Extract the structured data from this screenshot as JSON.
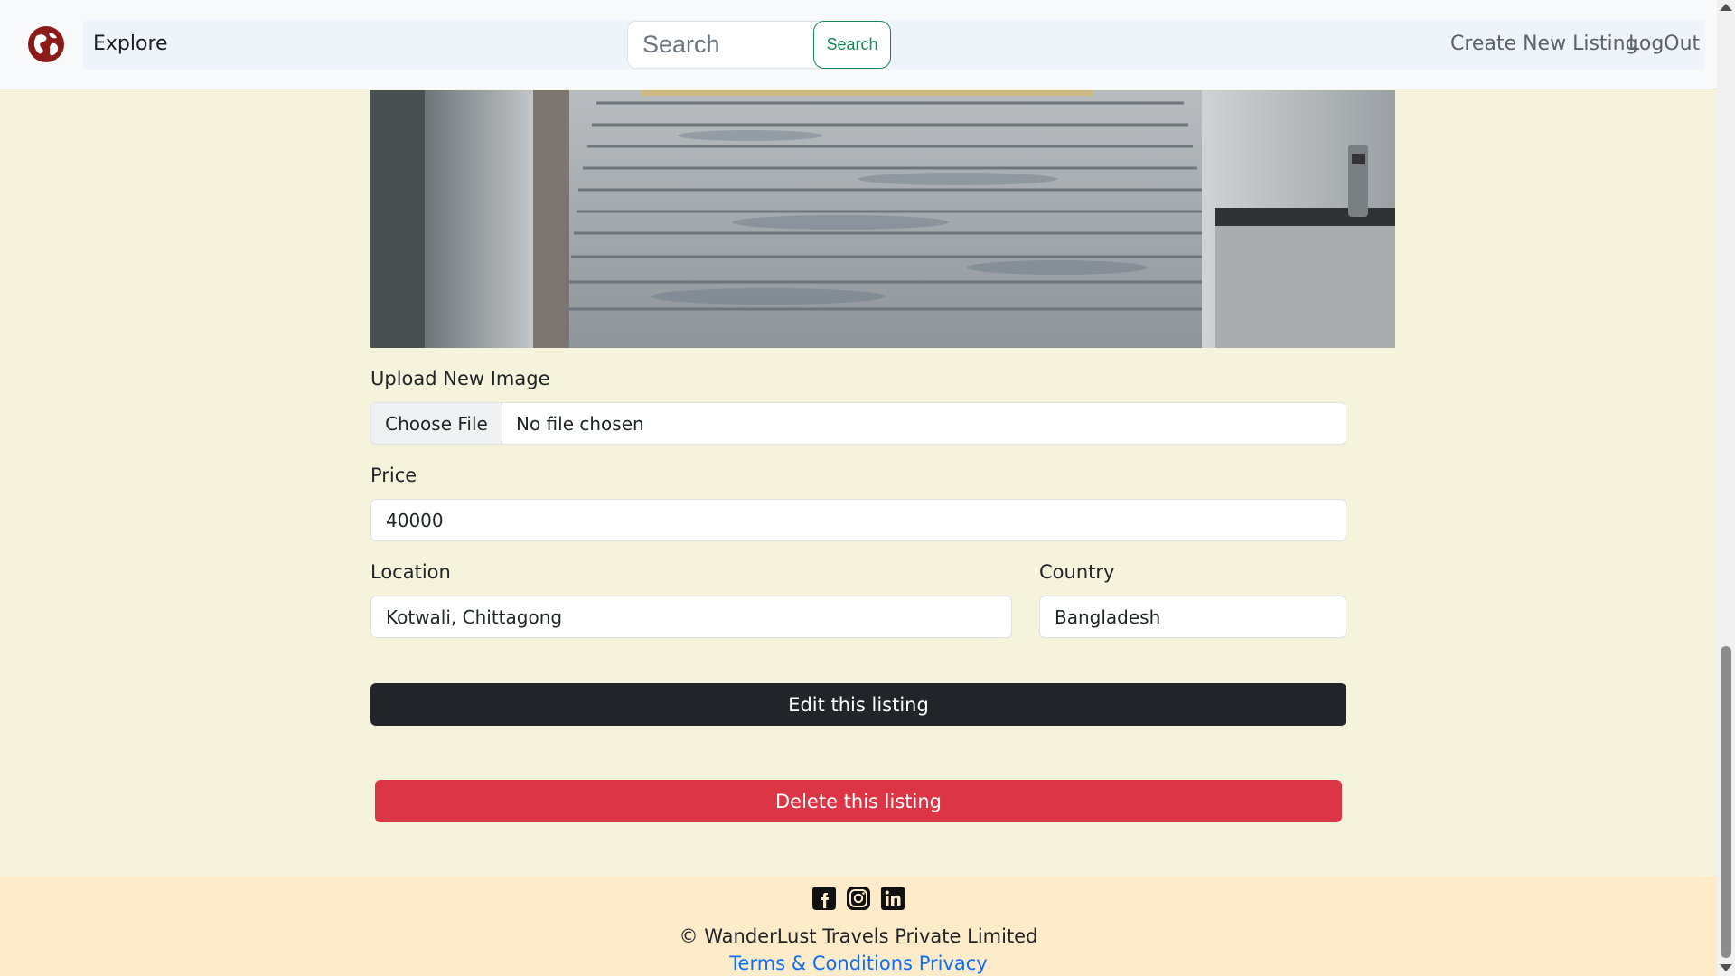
{
  "navbar": {
    "brand_icon": "compass-globe-icon",
    "explore_label": "Explore",
    "search": {
      "placeholder": "Search",
      "value": "",
      "button_label": "Search"
    },
    "create_listing_label": "Create New Listing",
    "logout_label": "LogOut"
  },
  "form": {
    "upload_label": "Upload New Image",
    "file_button_label": "Choose File",
    "file_status": "No file chosen",
    "price_label": "Price",
    "price_value": "40000",
    "location_label": "Location",
    "location_value": "Kotwali, Chittagong",
    "country_label": "Country",
    "country_value": "Bangladesh",
    "edit_button_label": "Edit this listing",
    "delete_button_label": "Delete this listing"
  },
  "footer": {
    "social_icons": [
      "facebook-icon",
      "instagram-icon",
      "linkedin-icon"
    ],
    "copyright": "© WanderLust Travels Private Limited",
    "terms_label": "Terms & Conditions",
    "privacy_label": "Privacy"
  },
  "colors": {
    "brand": "#8b1a1a",
    "page_background": "#f5f3dc",
    "footer_background": "#fdebc9",
    "edit_button": "#212529",
    "delete_button": "#dc3545",
    "search_button": "#198754",
    "link": "#0d6efd"
  }
}
